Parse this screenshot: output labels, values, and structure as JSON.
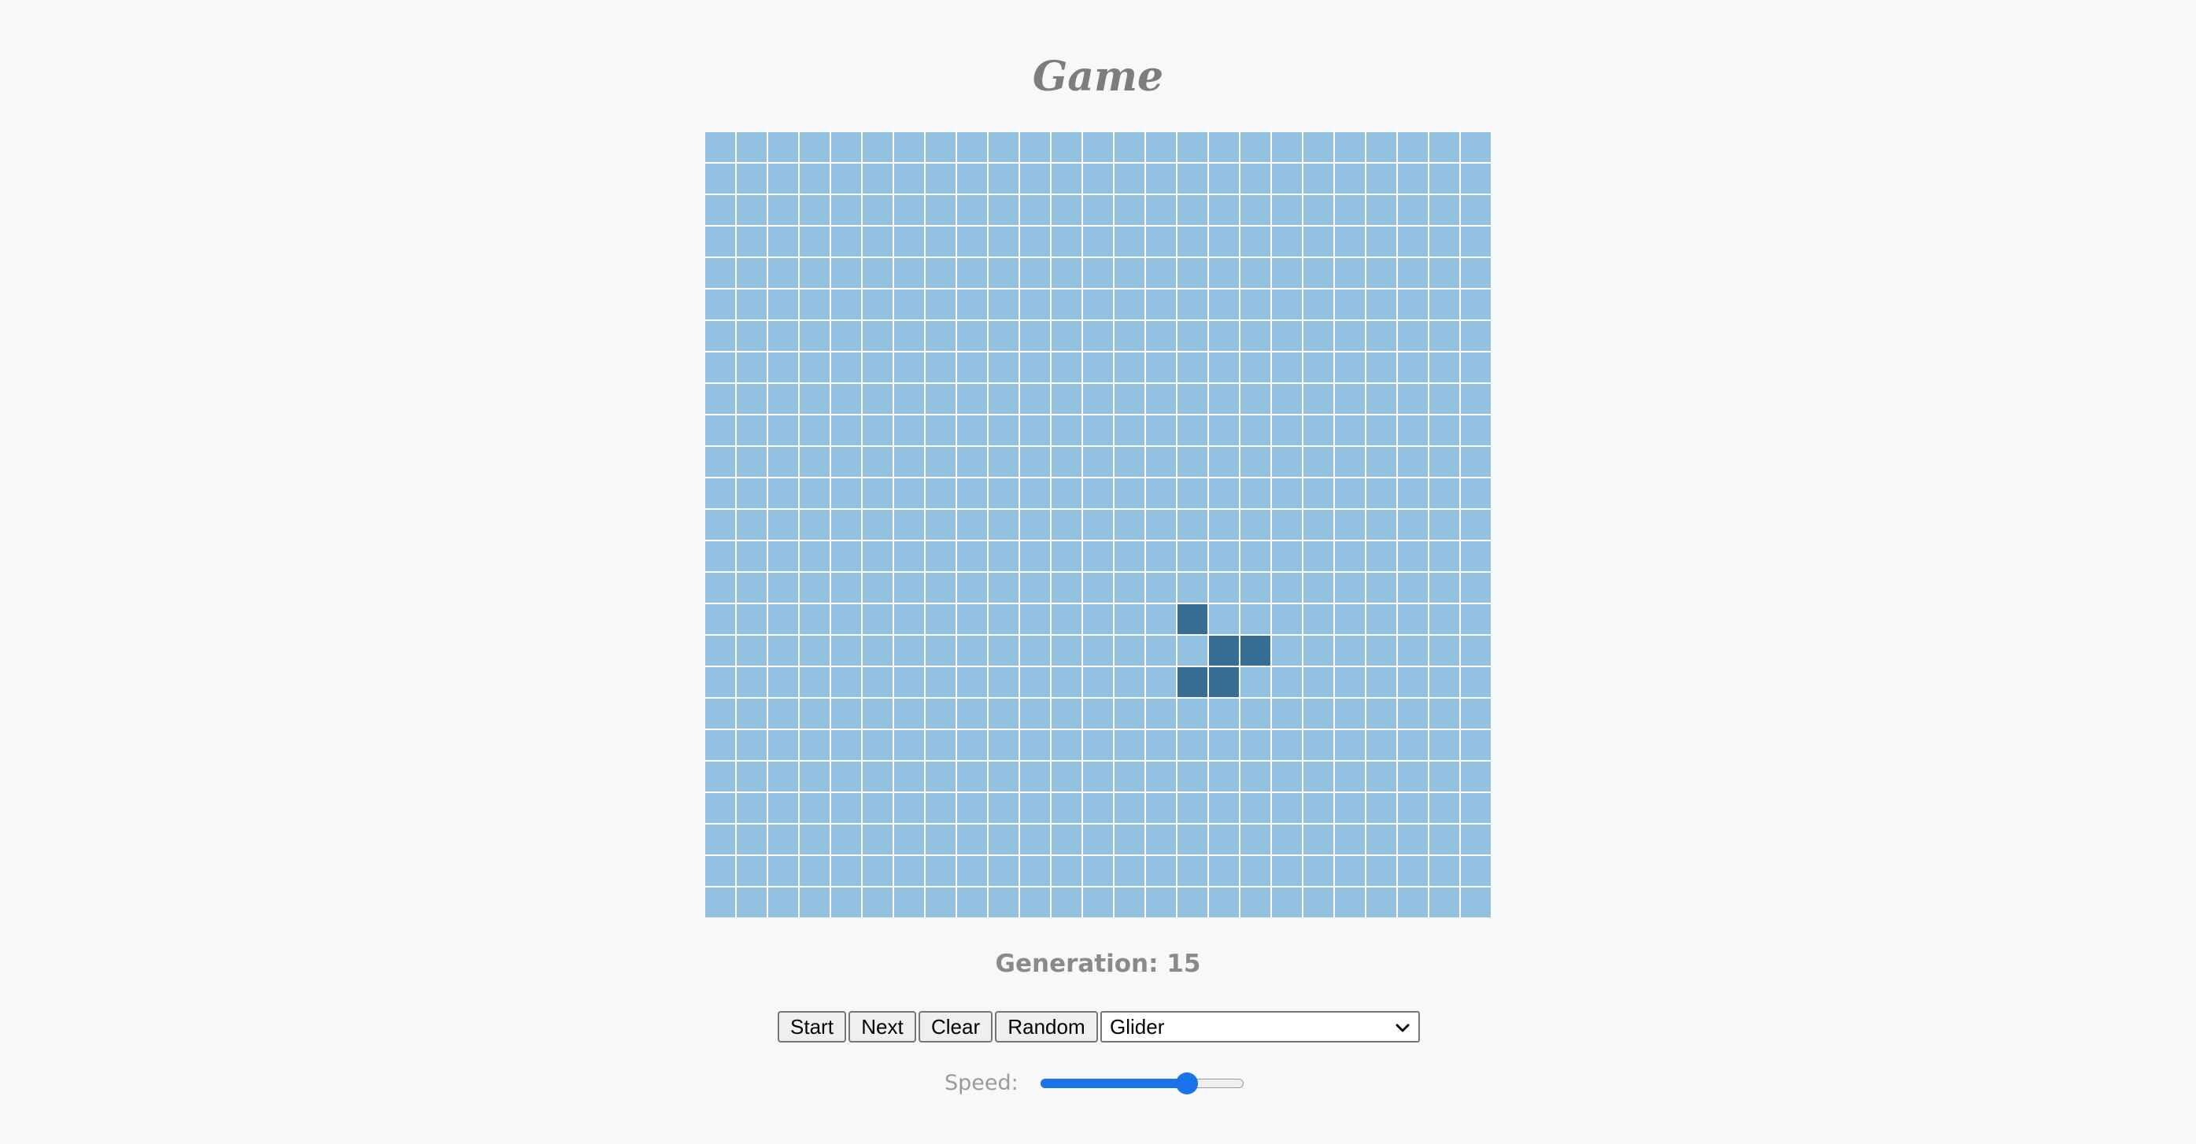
{
  "title": "Game",
  "board": {
    "rows": 25,
    "cols": 25,
    "live_cells": [
      [
        15,
        15
      ],
      [
        16,
        16
      ],
      [
        16,
        17
      ],
      [
        17,
        15
      ],
      [
        17,
        16
      ]
    ],
    "colors": {
      "dead": "#93c1e1",
      "alive": "#376e93",
      "gridline": "#ffffff"
    }
  },
  "generation": {
    "text": "Generation: 15",
    "value": 15
  },
  "controls": {
    "start_label": "Start",
    "next_label": "Next",
    "clear_label": "Clear",
    "random_label": "Random",
    "pattern_selected": "Glider"
  },
  "speed": {
    "label": "Speed:",
    "value_fraction": 0.72
  },
  "icons": {
    "dropdown": "chevron-down-icon"
  }
}
